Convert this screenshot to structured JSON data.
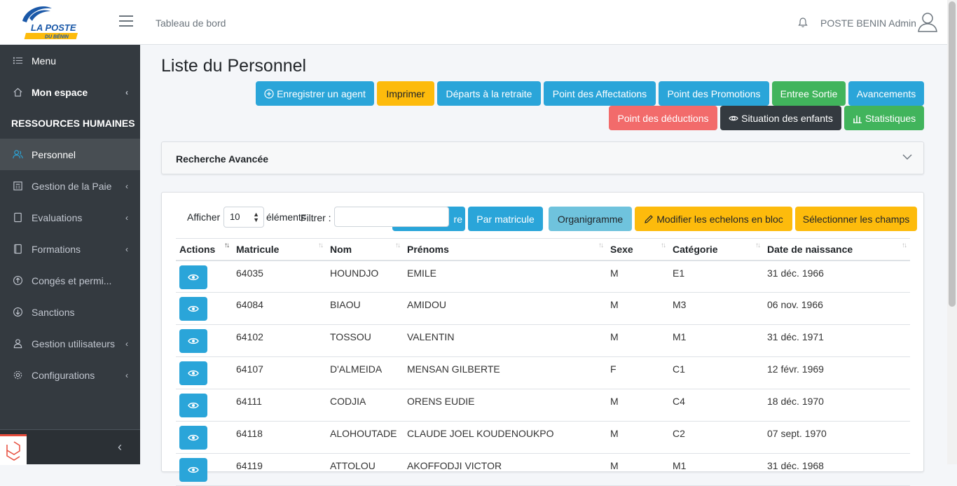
{
  "header": {
    "logo_text": "LA POSTE",
    "logo_subtext": "DU BÉNIN",
    "breadcrumb": "Tableau de bord",
    "admin_name": "POSTE BENIN Admin"
  },
  "sidebar": {
    "menu_label": "Menu",
    "my_space": "Mon espace",
    "section_header": "RESSOURCES HUMAINES",
    "items": [
      {
        "label": "Personnel",
        "icon": "users-icon"
      },
      {
        "label": "Gestion de la Paie",
        "icon": "calculator-icon"
      },
      {
        "label": "Evaluations",
        "icon": "clipboard-icon"
      },
      {
        "label": "Formations",
        "icon": "book-icon"
      },
      {
        "label": "Congés et permi...",
        "icon": "arrow-up-circle-icon"
      },
      {
        "label": "Sanctions",
        "icon": "arrow-down-circle-icon"
      },
      {
        "label": "Gestion utilisateurs",
        "icon": "user-icon"
      },
      {
        "label": "Configurations",
        "icon": "gear-icon"
      }
    ]
  },
  "page": {
    "title": "Liste du Personnel",
    "buttons": {
      "register": "Enregistrer un agent",
      "print": "Imprimer",
      "retirement": "Départs à la retraite",
      "assignments": "Point des Affectations",
      "promotions": "Point des Promotions",
      "entry_exit": "Entree Sortie",
      "advancements": "Avancements",
      "deductions": "Point des déductions",
      "children": "Situation des enfants",
      "statistics": "Statistiques"
    },
    "advanced_search": "Recherche Avancée"
  },
  "datatable": {
    "show_label": "Afficher",
    "page_length": "10",
    "elements_label": "éléments",
    "filter_label": "Filtrer :",
    "filter_value": "",
    "hidden_button_tail": "re",
    "by_matricule": "Par matricule",
    "org_chart": "Organigramme",
    "edit_levels": "Modifier les echelons en bloc",
    "select_fields": "Sélectionner les champs",
    "columns": [
      "Actions",
      "Matricule",
      "Nom",
      "Prénoms",
      "Sexe",
      "Catégorie",
      "Date de naissance"
    ],
    "rows": [
      [
        "64035",
        "HOUNDJO",
        "EMILE",
        "M",
        "E1",
        "31 déc. 1966"
      ],
      [
        "64084",
        "BIAOU",
        "AMIDOU",
        "M",
        "M3",
        "06 nov. 1966"
      ],
      [
        "64102",
        "TOSSOU",
        "VALENTIN",
        "M",
        "M1",
        "31 déc. 1971"
      ],
      [
        "64107",
        "D'ALMEIDA",
        "MENSAN GILBERTE",
        "F",
        "C1",
        "12 févr. 1969"
      ],
      [
        "64111",
        "CODJIA",
        "ORENS EUDIE",
        "M",
        "C4",
        "18 déc. 1970"
      ],
      [
        "64118",
        "ALOHOUTADE",
        "CLAUDE JOEL KOUDENOUKPO",
        "M",
        "C2",
        "07 sept. 1970"
      ],
      [
        "64119",
        "ATTOLOU",
        "AKOFFODJI VICTOR",
        "M",
        "M1",
        "31 déc. 1968"
      ]
    ]
  },
  "colors": {
    "info": "#2aa5d9",
    "warning": "#fdbb0c",
    "success": "#41b45c",
    "danger": "#f26b6b",
    "dark": "#343a40",
    "sidebar": "#343a40"
  }
}
